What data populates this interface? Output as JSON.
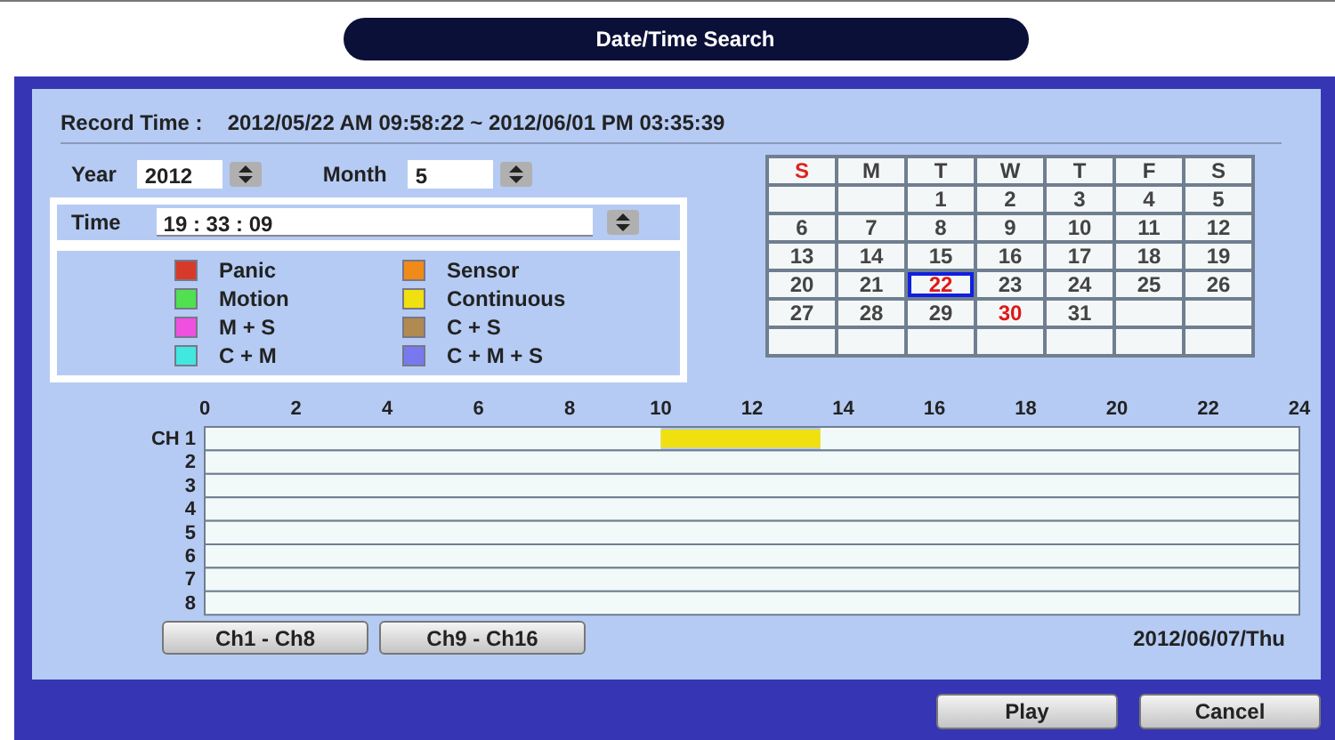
{
  "window": {
    "title": "Date/Time Search"
  },
  "record_time": {
    "label": "Record Time :",
    "value": "2012/05/22 AM 09:58:22 ~ 2012/06/01 PM 03:35:39"
  },
  "year": {
    "label": "Year",
    "value": "2012"
  },
  "month": {
    "label": "Month",
    "value": "5"
  },
  "time": {
    "label": "Time",
    "value": "19 : 33 : 09"
  },
  "legend": [
    {
      "label": "Panic",
      "color": "#d83a2a"
    },
    {
      "label": "Sensor",
      "color": "#f08a18"
    },
    {
      "label": "Motion",
      "color": "#50e050"
    },
    {
      "label": "Continuous",
      "color": "#f0e010"
    },
    {
      "label": "M + S",
      "color": "#f050e0"
    },
    {
      "label": "C + S",
      "color": "#b08a50"
    },
    {
      "label": "C + M",
      "color": "#40e8e0"
    },
    {
      "label": "C + M + S",
      "color": "#7878f0"
    }
  ],
  "calendar": {
    "weekdays": [
      {
        "label": "S",
        "color": "#e02020"
      },
      {
        "label": "M",
        "color": "#404040"
      },
      {
        "label": "T",
        "color": "#404040"
      },
      {
        "label": "W",
        "color": "#404040"
      },
      {
        "label": "T",
        "color": "#404040"
      },
      {
        "label": "F",
        "color": "#404040"
      },
      {
        "label": "S",
        "color": "#404040"
      }
    ],
    "weeks": [
      [
        {
          "kind": "blank"
        },
        {
          "kind": "blank"
        },
        {
          "kind": "day",
          "day": "1",
          "selected": false,
          "marked": false
        },
        {
          "day": "2",
          "selected": false,
          "marked": false
        },
        {
          "day": "3",
          "selected": false,
          "marked": false
        },
        {
          "day": "4",
          "selected": false,
          "marked": false
        },
        {
          "day": "5",
          "selected": false,
          "marked": false
        }
      ],
      [
        {
          "day": "6",
          "selected": false,
          "marked": false
        },
        {
          "day": "7",
          "selected": false,
          "marked": false
        },
        {
          "day": "8",
          "selected": false,
          "marked": false
        },
        {
          "day": "9",
          "selected": false,
          "marked": false
        },
        {
          "day": "10",
          "selected": false,
          "marked": false
        },
        {
          "day": "11",
          "selected": false,
          "marked": false
        },
        {
          "day": "12",
          "selected": false,
          "marked": false
        }
      ],
      [
        {
          "day": "13",
          "selected": false,
          "marked": false
        },
        {
          "day": "14",
          "selected": false,
          "marked": false
        },
        {
          "day": "15",
          "selected": false,
          "marked": false
        },
        {
          "day": "16",
          "selected": false,
          "marked": false
        },
        {
          "day": "17",
          "selected": false,
          "marked": false
        },
        {
          "day": "18",
          "selected": false,
          "marked": false
        },
        {
          "day": "19",
          "selected": false,
          "marked": false
        }
      ],
      [
        {
          "day": "20",
          "selected": false,
          "marked": false
        },
        {
          "day": "21",
          "selected": false,
          "marked": false
        },
        {
          "day": "22",
          "selected": true,
          "marked": true
        },
        {
          "day": "23",
          "selected": false,
          "marked": false
        },
        {
          "day": "24",
          "selected": false,
          "marked": false
        },
        {
          "day": "25",
          "selected": false,
          "marked": false
        },
        {
          "day": "26",
          "selected": false,
          "marked": false
        }
      ],
      [
        {
          "day": "27",
          "selected": false,
          "marked": false
        },
        {
          "day": "28",
          "selected": false,
          "marked": false
        },
        {
          "day": "29",
          "selected": false,
          "marked": false
        },
        {
          "day": "30",
          "selected": false,
          "marked": true
        },
        {
          "day": "31",
          "selected": false,
          "marked": false
        },
        {
          "kind": "blank"
        },
        {
          "kind": "blank"
        }
      ],
      [
        {
          "kind": "blank"
        },
        {
          "kind": "blank"
        },
        {
          "kind": "blank"
        },
        {
          "kind": "blank"
        },
        {
          "kind": "blank"
        },
        {
          "kind": "blank"
        },
        {
          "kind": "blank"
        }
      ]
    ]
  },
  "timeline": {
    "chart_data": {
      "type": "bar",
      "orientation": "horizontal",
      "stacked": true,
      "categories": [
        "CH 1",
        "2",
        "3",
        "4",
        "5",
        "6",
        "7",
        "8"
      ],
      "xlim": [
        0,
        24
      ],
      "xticks": [
        0,
        2,
        4,
        6,
        8,
        10,
        12,
        14,
        16,
        18,
        20,
        22,
        24
      ],
      "series": [
        {
          "color": "#f2f9f9",
          "values": [
            10,
            24,
            24,
            24,
            24,
            24,
            24,
            24
          ]
        },
        {
          "color": "#f0e010",
          "values": [
            3.5,
            0,
            0,
            0,
            0,
            0,
            0,
            0
          ]
        },
        {
          "color": "#f2f9f9",
          "values": [
            10.5,
            0,
            0,
            0,
            0,
            0,
            0,
            0
          ]
        }
      ]
    }
  },
  "channel_buttons": [
    "Ch1 - Ch8",
    "Ch9 - Ch16"
  ],
  "current_date": "2012/06/07/Thu",
  "buttons": [
    "Play",
    "Cancel"
  ]
}
